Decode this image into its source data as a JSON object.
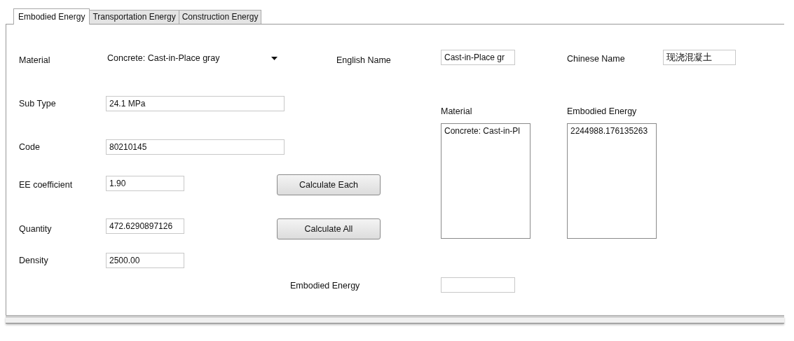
{
  "tabs": [
    {
      "label": "Embodied Energy",
      "selected": true
    },
    {
      "label": "Transportation Energy",
      "selected": false
    },
    {
      "label": "Construction Energy",
      "selected": false
    }
  ],
  "form": {
    "material": {
      "label": "Material",
      "value": "Concrete: Cast-in-Place gray"
    },
    "sub_type": {
      "label": "Sub Type",
      "value": "24.1 MPa"
    },
    "code": {
      "label": "Code",
      "value": "80210145"
    },
    "ee_coefficient": {
      "label": "EE coefficient",
      "value": "1.90"
    },
    "quantity": {
      "label": "Quantity",
      "value": "472.6290897126"
    },
    "density": {
      "label": "Density",
      "value": "2500.00"
    }
  },
  "buttons": [
    "Calculate Each",
    "Calculate All"
  ],
  "english_name": {
    "label": "English Name",
    "value": "Cast-in-Place gr"
  },
  "chinese_name": {
    "label": "Chinese Name",
    "value": "现浇混凝土"
  },
  "material_list": {
    "label": "Material",
    "items": [
      "Concrete: Cast-in-Pl"
    ]
  },
  "energy_list": {
    "label": "Embodied Energy",
    "items": [
      "2244988.176135263"
    ]
  },
  "total": {
    "label": "Embodied Energy"
  }
}
